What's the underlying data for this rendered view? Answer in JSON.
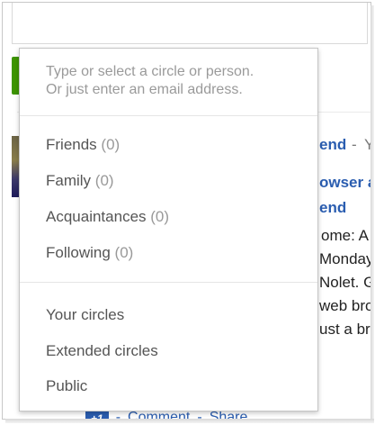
{
  "dropdown": {
    "hint_line1": "Type or select a circle or person.",
    "hint_line2": "Or just enter an email address.",
    "circles": [
      {
        "label": "Friends",
        "count": "(0)"
      },
      {
        "label": "Family",
        "count": "(0)"
      },
      {
        "label": "Acquaintances",
        "count": "(0)"
      },
      {
        "label": "Following",
        "count": "(0)"
      }
    ],
    "scopes": [
      {
        "label": "Your circles"
      },
      {
        "label": "Extended circles"
      },
      {
        "label": "Public"
      }
    ]
  },
  "background": {
    "link1": "end",
    "link1_sep": "-",
    "link1_trailing": "Y",
    "link2": "owser ar",
    "link3": "end",
    "body_lines": [
      "ome: A",
      "Monday,",
      "Nolet. G",
      "web brow",
      "ust a bre"
    ]
  },
  "bottom": {
    "plusone": "+1",
    "separator": "-",
    "comment": "Comment",
    "share": "Share"
  },
  "colors": {
    "link_blue": "#2a5db0",
    "green_button": "#3d9400"
  }
}
